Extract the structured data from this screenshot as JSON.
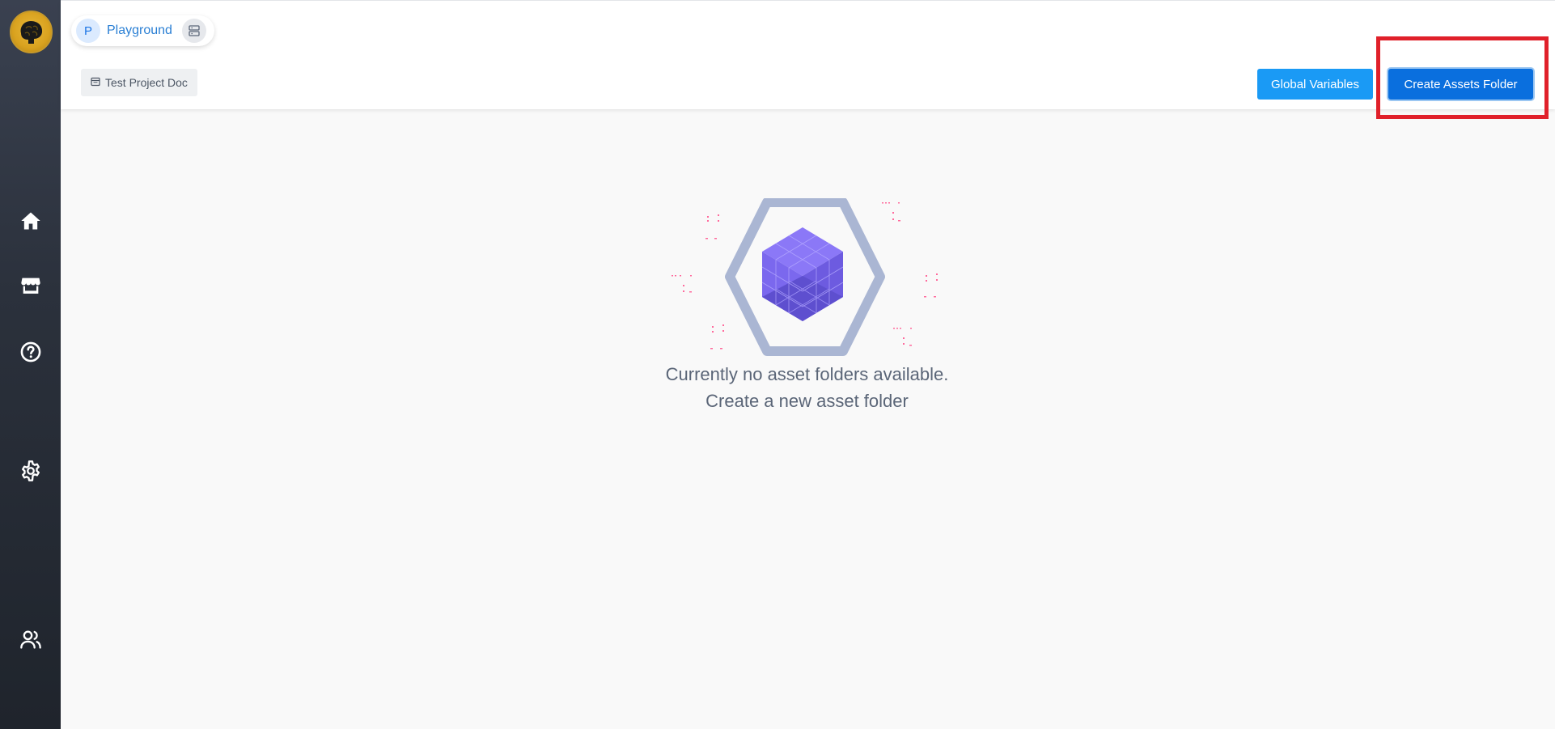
{
  "sidebar": {
    "logo": "brain-logo",
    "items": [
      {
        "name": "home",
        "icon": "home-icon"
      },
      {
        "name": "marketplace",
        "icon": "store-icon"
      },
      {
        "name": "help",
        "icon": "help-icon"
      },
      {
        "name": "settings",
        "icon": "gear-icon"
      },
      {
        "name": "users",
        "icon": "users-icon"
      }
    ]
  },
  "header": {
    "project_initial": "P",
    "project_name": "Playground",
    "doc_tag": "Test Project Doc",
    "global_variables_label": "Global Variables",
    "create_folder_label": "Create Assets Folder"
  },
  "empty_state": {
    "line1": "Currently no asset folders available.",
    "line2": "Create a new asset folder"
  },
  "colors": {
    "primary": "#0a6fde",
    "secondary_button": "#1a9af5",
    "highlight": "#e0202a",
    "cube": "#7b68ee"
  }
}
